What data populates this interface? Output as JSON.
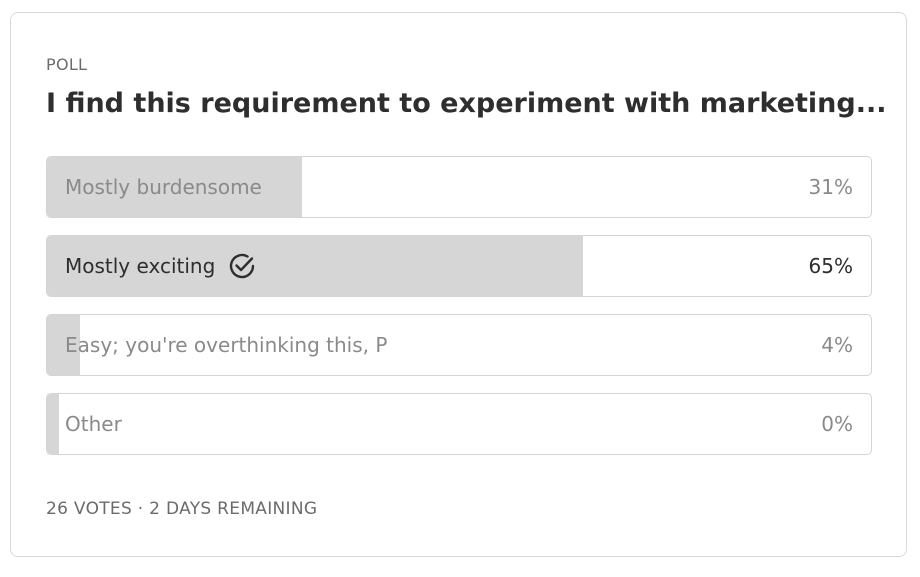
{
  "poll": {
    "eyebrow": "POLL",
    "question": "I find this requirement to experiment with marketing...",
    "options": [
      {
        "label": "Mostly burdensome",
        "percent_text": "31%",
        "fill_percent": 31,
        "selected": false
      },
      {
        "label": "Mostly exciting",
        "percent_text": "65%",
        "fill_percent": 65,
        "selected": true
      },
      {
        "label": "Easy; you're overthinking this, P",
        "percent_text": "4%",
        "fill_percent": 4,
        "selected": false
      },
      {
        "label": "Other",
        "percent_text": "0%",
        "fill_percent": 0,
        "selected": false
      }
    ],
    "footer": "26 VOTES · 2 DAYS REMAINING"
  },
  "colors": {
    "fill": "#d6d6d6",
    "border": "#d4d4d4",
    "text_dark": "#2e2e2e",
    "text_muted": "#8a8a8a"
  },
  "icons": {
    "selected_marker": "check-circle-icon"
  }
}
